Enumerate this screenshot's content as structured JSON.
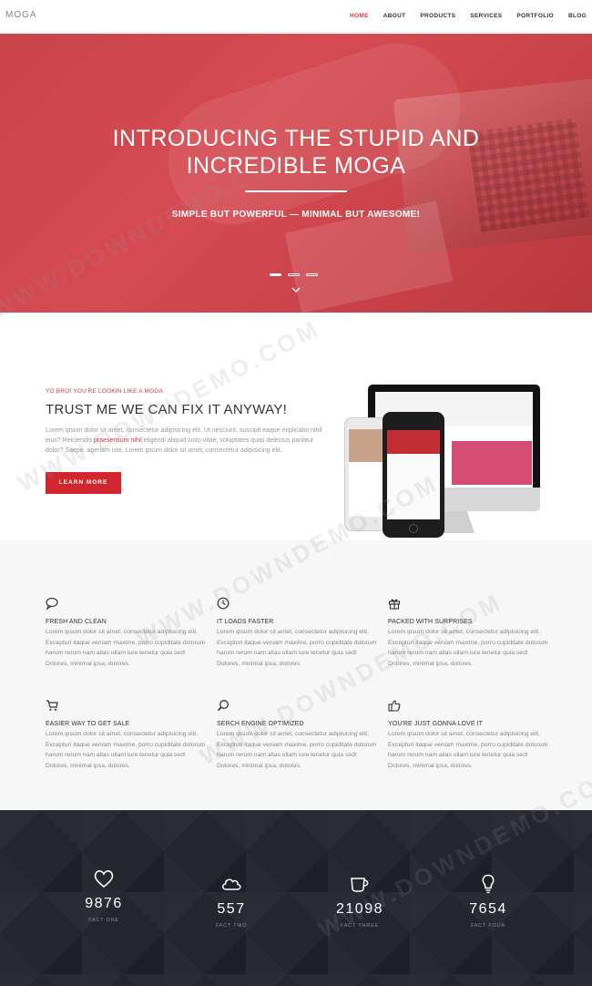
{
  "nav": {
    "brand": "MOGA",
    "items": [
      {
        "label": "HOME",
        "active": true
      },
      {
        "label": "ABOUT",
        "active": false
      },
      {
        "label": "PRODUCTS",
        "active": false
      },
      {
        "label": "SERVICES",
        "active": false
      },
      {
        "label": "PORTFOLIO",
        "active": false
      },
      {
        "label": "BLOG",
        "active": false
      }
    ]
  },
  "hero": {
    "title_line1": "INTRODUCING THE STUPID AND",
    "title_line2": "INCREDIBLE MOGA",
    "tagline": "SIMPLE BUT POWERFUL — MINIMAL BUT AWESOME!",
    "slides": 3,
    "active_slide": 1
  },
  "intro": {
    "eyebrow": "YO BRO! YOU'RE LOOKIN LIKE A MOGA",
    "title": "TRUST ME WE CAN FIX IT ANYWAY!",
    "text_before": "Lorem ipsum dolor sit amet, consectetur adipisicing elit. Ut nesciunt, suscipit eaque explicabo nihil eius? Reiciendis ",
    "text_highlight": "praesentium nihil",
    "text_after": " eligendi aliquid iusto vitae, voluptates quas delectus pariatur dolor? Saepe, aperiam iste. Lorem ipsum dolor sit amet, consectetur adipisicing elit.",
    "button": "LEARN MORE"
  },
  "features": [
    {
      "icon": "speech-bubble-icon",
      "title": "FRESH AND CLEAN",
      "text": "Lorem ipsum dolor sit amet, consectetur adipisicing elit. Excepturi itaque veniam maxime, porro cupiditate dolorum harum rerum nam alias ullam iure tenetur quia sed! Dolores, minimal ipsa, dolores."
    },
    {
      "icon": "clock-icon",
      "title": "IT LOADS FASTER",
      "text": "Lorem ipsum dolor sit amet, consectetur adipisicing elit. Excepturi itaque veniam maxime, porro cupiditate dolorum harum rerum nam alias ullam iure tenetur quia sed! Dolores, minimal ipsa, dolores."
    },
    {
      "icon": "gift-icon",
      "title": "PACKED WITH SURPRISES",
      "text": "Lorem ipsum dolor sit amet, consectetur adipisicing elit. Excepturi itaque veniam maxime, porro cupiditate dolorum harum rerum nam alias ullam iure tenetur quia sed! Dolores, minimal ipsa, dolores."
    },
    {
      "icon": "cart-icon",
      "title": "EASIER WAY TO GET SALE",
      "text": "Lorem ipsum dolor sit amet, consectetur adipisicing elit. Excepturi itaque veniam maxime, porro cupiditate dolorum harum rerum nam alias ullam iure tenetur quia sed! Dolores, minimal ipsa, dolores."
    },
    {
      "icon": "search-icon",
      "title": "SERCH ENGINE OPTIMIZED",
      "text": "Lorem ipsum dolor sit amet, consectetur adipisicing elit. Excepturi itaque veniam maxime, porro cupiditate dolorum harum rerum nam alias ullam iure tenetur quia sed! Dolores, minimal ipsa, dolores."
    },
    {
      "icon": "thumbs-up-icon",
      "title": "YOU'RE JUST GONNA LOVE IT",
      "text": "Lorem ipsum dolor sit amet, consectetur adipisicing elit. Excepturi itaque veniam maxime, porro cupiditate dolorum harum rerum nam alias ullam iure tenetur quia sed! Dolores, minimal ipsa, dolores."
    }
  ],
  "stats": [
    {
      "icon": "heart-icon",
      "number": "9876",
      "label": "FACT ONE"
    },
    {
      "icon": "cloud-icon",
      "number": "557",
      "label": "FACT TWO"
    },
    {
      "icon": "cup-icon",
      "number": "21098",
      "label": "FACT THREE"
    },
    {
      "icon": "bulb-icon",
      "number": "7654",
      "label": "FACT FOUR"
    }
  ],
  "watermark": "WWW.DOWNDEMO.COM",
  "colors": {
    "accent": "#d1262d",
    "hero": "#d64b53",
    "dark": "#24262d"
  }
}
